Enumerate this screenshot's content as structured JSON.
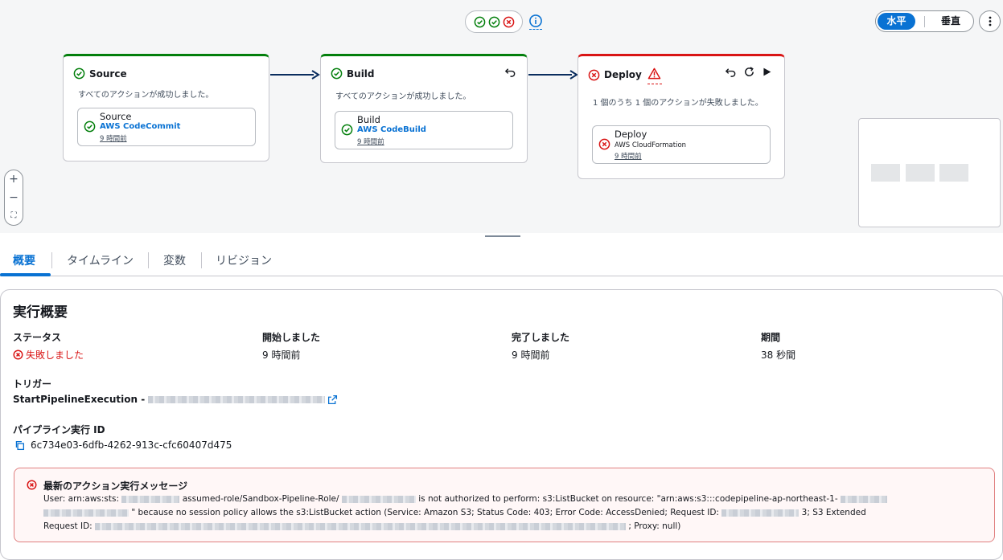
{
  "colors": {
    "success": "#037f0c",
    "failure": "#d91515",
    "link": "#0972d3",
    "arrow": "#0a2d5e"
  },
  "toolbar": {
    "status_icons": [
      "success-icon",
      "success-icon",
      "failure-icon"
    ],
    "info_icon": "info-icon",
    "orientation_horizontal": "水平",
    "orientation_vertical": "垂直",
    "more_icon": "more-vertical-icon"
  },
  "stages": [
    {
      "title": "Source",
      "status": "success",
      "description": "すべてのアクションが成功しました。",
      "action": {
        "name": "Source",
        "provider": "AWS CodeCommit",
        "time": "9 時間前",
        "status": "success"
      }
    },
    {
      "title": "Build",
      "status": "success",
      "description": "すべてのアクションが成功しました。",
      "action": {
        "name": "Build",
        "provider": "AWS CodeBuild",
        "time": "9 時間前",
        "status": "success"
      }
    },
    {
      "title": "Deploy",
      "status": "failed",
      "description": "1 個のうち 1 個のアクションが失敗しました。",
      "action": {
        "name": "Deploy",
        "provider": "AWS CloudFormation",
        "time": "9 時間前",
        "status": "failed"
      }
    }
  ],
  "zoom": {
    "in": "+",
    "out": "−",
    "fit": "⛶"
  },
  "tabs": [
    "概要",
    "タイムライン",
    "変数",
    "リビジョン"
  ],
  "summary": {
    "title": "実行概要",
    "status_label": "ステータス",
    "status_value": "失敗しました",
    "started_label": "開始しました",
    "started_value": "9 時間前",
    "completed_label": "完了しました",
    "completed_value": "9 時間前",
    "duration_label": "期間",
    "duration_value": "38 秒間",
    "trigger_label": "トリガー",
    "trigger_value": "StartPipelineExecution - ",
    "execution_id_label": "パイプライン実行 ID",
    "execution_id_value": "6c734e03-6dfb-4262-913c-cfc60407d475"
  },
  "error": {
    "title": "最新のアクション実行メッセージ",
    "line1_a": "User: arn:aws:sts:",
    "line1_b": "assumed-role/Sandbox-Pipeline-Role/",
    "line1_c": "is not authorized to perform: s3:ListBucket on resource: \"arn:aws:s3:::codepipeline-ap-northeast-1-",
    "line2_a": "\" because no session policy allows the s3:ListBucket action (Service: Amazon S3; Status Code: 403; Error Code: AccessDenied; Request ID:",
    "line2_b": "3; S3 Extended",
    "line3_a": "Request ID:",
    "line3_b": "; Proxy: null)"
  }
}
